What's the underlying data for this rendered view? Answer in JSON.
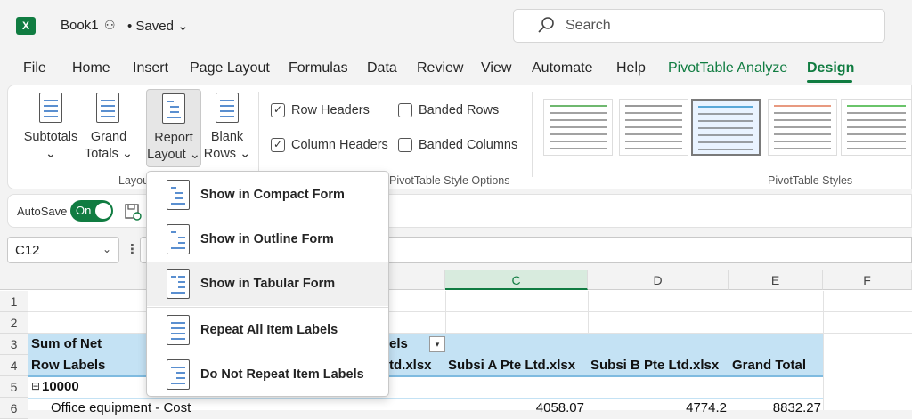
{
  "app": {
    "logo": "X",
    "doc_title": "Book1",
    "save_status": "• Saved"
  },
  "search": {
    "placeholder": "Search"
  },
  "menu": [
    "File",
    "Home",
    "Insert",
    "Page Layout",
    "Formulas",
    "Data",
    "Review",
    "View",
    "Automate",
    "Help",
    "PivotTable Analyze",
    "Design"
  ],
  "ribbon": {
    "subtotals": {
      "line1": "Subtotals",
      "line2": "⌄"
    },
    "grand_totals": {
      "line1": "Grand",
      "line2": "Totals ⌄"
    },
    "report_layout": {
      "line1": "Report",
      "line2": "Layout ⌄"
    },
    "blank_rows": {
      "line1": "Blank",
      "line2": "Rows ⌄"
    },
    "layout_group_label": "Layout",
    "options": [
      {
        "label": "Row Headers",
        "checked": true
      },
      {
        "label": "Banded Rows",
        "checked": false
      },
      {
        "label": "Column Headers",
        "checked": true
      },
      {
        "label": "Banded Columns",
        "checked": false
      }
    ],
    "style_options_label": "PivotTable Style Options",
    "styles_label": "PivotTable Styles",
    "style_colors": [
      "#6fb86f",
      "#9a9a9a",
      "#5aa8d8",
      "#e89a80",
      "#6ac46a"
    ]
  },
  "autosave": {
    "label": "AutoSave",
    "toggle": "On"
  },
  "formula_bar": {
    "name_box": "C12",
    "name_box_chevron": "⌄",
    "colon": "⋮"
  },
  "grid": {
    "columns": [
      "C",
      "D",
      "E",
      "F"
    ],
    "rows": [
      "1",
      "2",
      "3",
      "4",
      "5",
      "6"
    ],
    "a3": "Sum of Net",
    "b3_partial": "els",
    "a4": "Row Labels",
    "b4_partial": "td.xlsx",
    "c4": "Subsi A Pte Ltd.xlsx",
    "d4": "Subsi B Pte Ltd.xlsx",
    "e4": "Grand Total",
    "a5": "10000",
    "a5_toggle": "⊟",
    "a6": "Office equipment - Cost",
    "c6": "4058.07",
    "d6": "4774.2",
    "e6": "8832.27"
  },
  "dropdown": {
    "items": [
      {
        "label": "Show in Compact Form"
      },
      {
        "label": "Show in Outline Form"
      },
      {
        "label": "Show in Tabular Form"
      },
      {
        "label": "Repeat All Item Labels"
      },
      {
        "label": "Do Not Repeat Item Labels"
      }
    ]
  }
}
